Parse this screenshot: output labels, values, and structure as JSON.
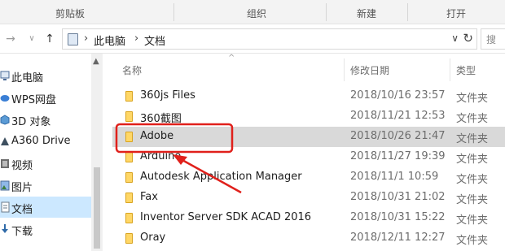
{
  "ribbon": {
    "groups": [
      "剪贴板",
      "组织",
      "新建",
      "打开"
    ]
  },
  "address": {
    "back_icon": "back-arrow-icon",
    "forward_icon": "forward-arrow-icon",
    "path": [
      "此电脑",
      "文档"
    ],
    "search_placeholder": "搜"
  },
  "sidebar": {
    "items": [
      {
        "label": "此电脑",
        "icon": "computer-icon"
      },
      {
        "label": "WPS网盘",
        "icon": "cloud-drive-icon"
      },
      {
        "label": "3D 对象",
        "icon": "3d-objects-icon"
      },
      {
        "label": "A360 Drive",
        "icon": "a360-drive-icon"
      },
      {
        "label": "视频",
        "icon": "video-icon"
      },
      {
        "label": "图片",
        "icon": "pictures-icon"
      },
      {
        "label": "文档",
        "icon": "documents-icon",
        "selected": true
      },
      {
        "label": "下载",
        "icon": "download-icon"
      }
    ]
  },
  "columns": {
    "name": "名称",
    "date": "修改日期",
    "type": "类型"
  },
  "files": [
    {
      "name": "360js Files",
      "date": "2018/10/16 23:57",
      "type": "文件夹"
    },
    {
      "name": "360截图",
      "date": "2018/11/21 12:53",
      "type": "文件夹"
    },
    {
      "name": "Adobe",
      "date": "2018/10/26 21:47",
      "type": "文件夹",
      "highlighted": true
    },
    {
      "name": "Arduino",
      "date": "2018/11/27 19:39",
      "type": "文件夹"
    },
    {
      "name": "Autodesk Application Manager",
      "date": "2018/11/1 10:59",
      "type": "文件夹"
    },
    {
      "name": "Fax",
      "date": "2018/10/31 21:02",
      "type": "文件夹"
    },
    {
      "name": "Inventor Server SDK ACAD 2016",
      "date": "2018/10/31 15:22",
      "type": "文件夹"
    },
    {
      "name": "Oray",
      "date": "2018/12/11 12:27",
      "type": "文件夹"
    }
  ],
  "colors": {
    "annotation_red": "#e0201b",
    "selection_blue": "#cce8ff",
    "row_highlight": "#d9d9d9",
    "folder_yellow": "#ffd766"
  }
}
